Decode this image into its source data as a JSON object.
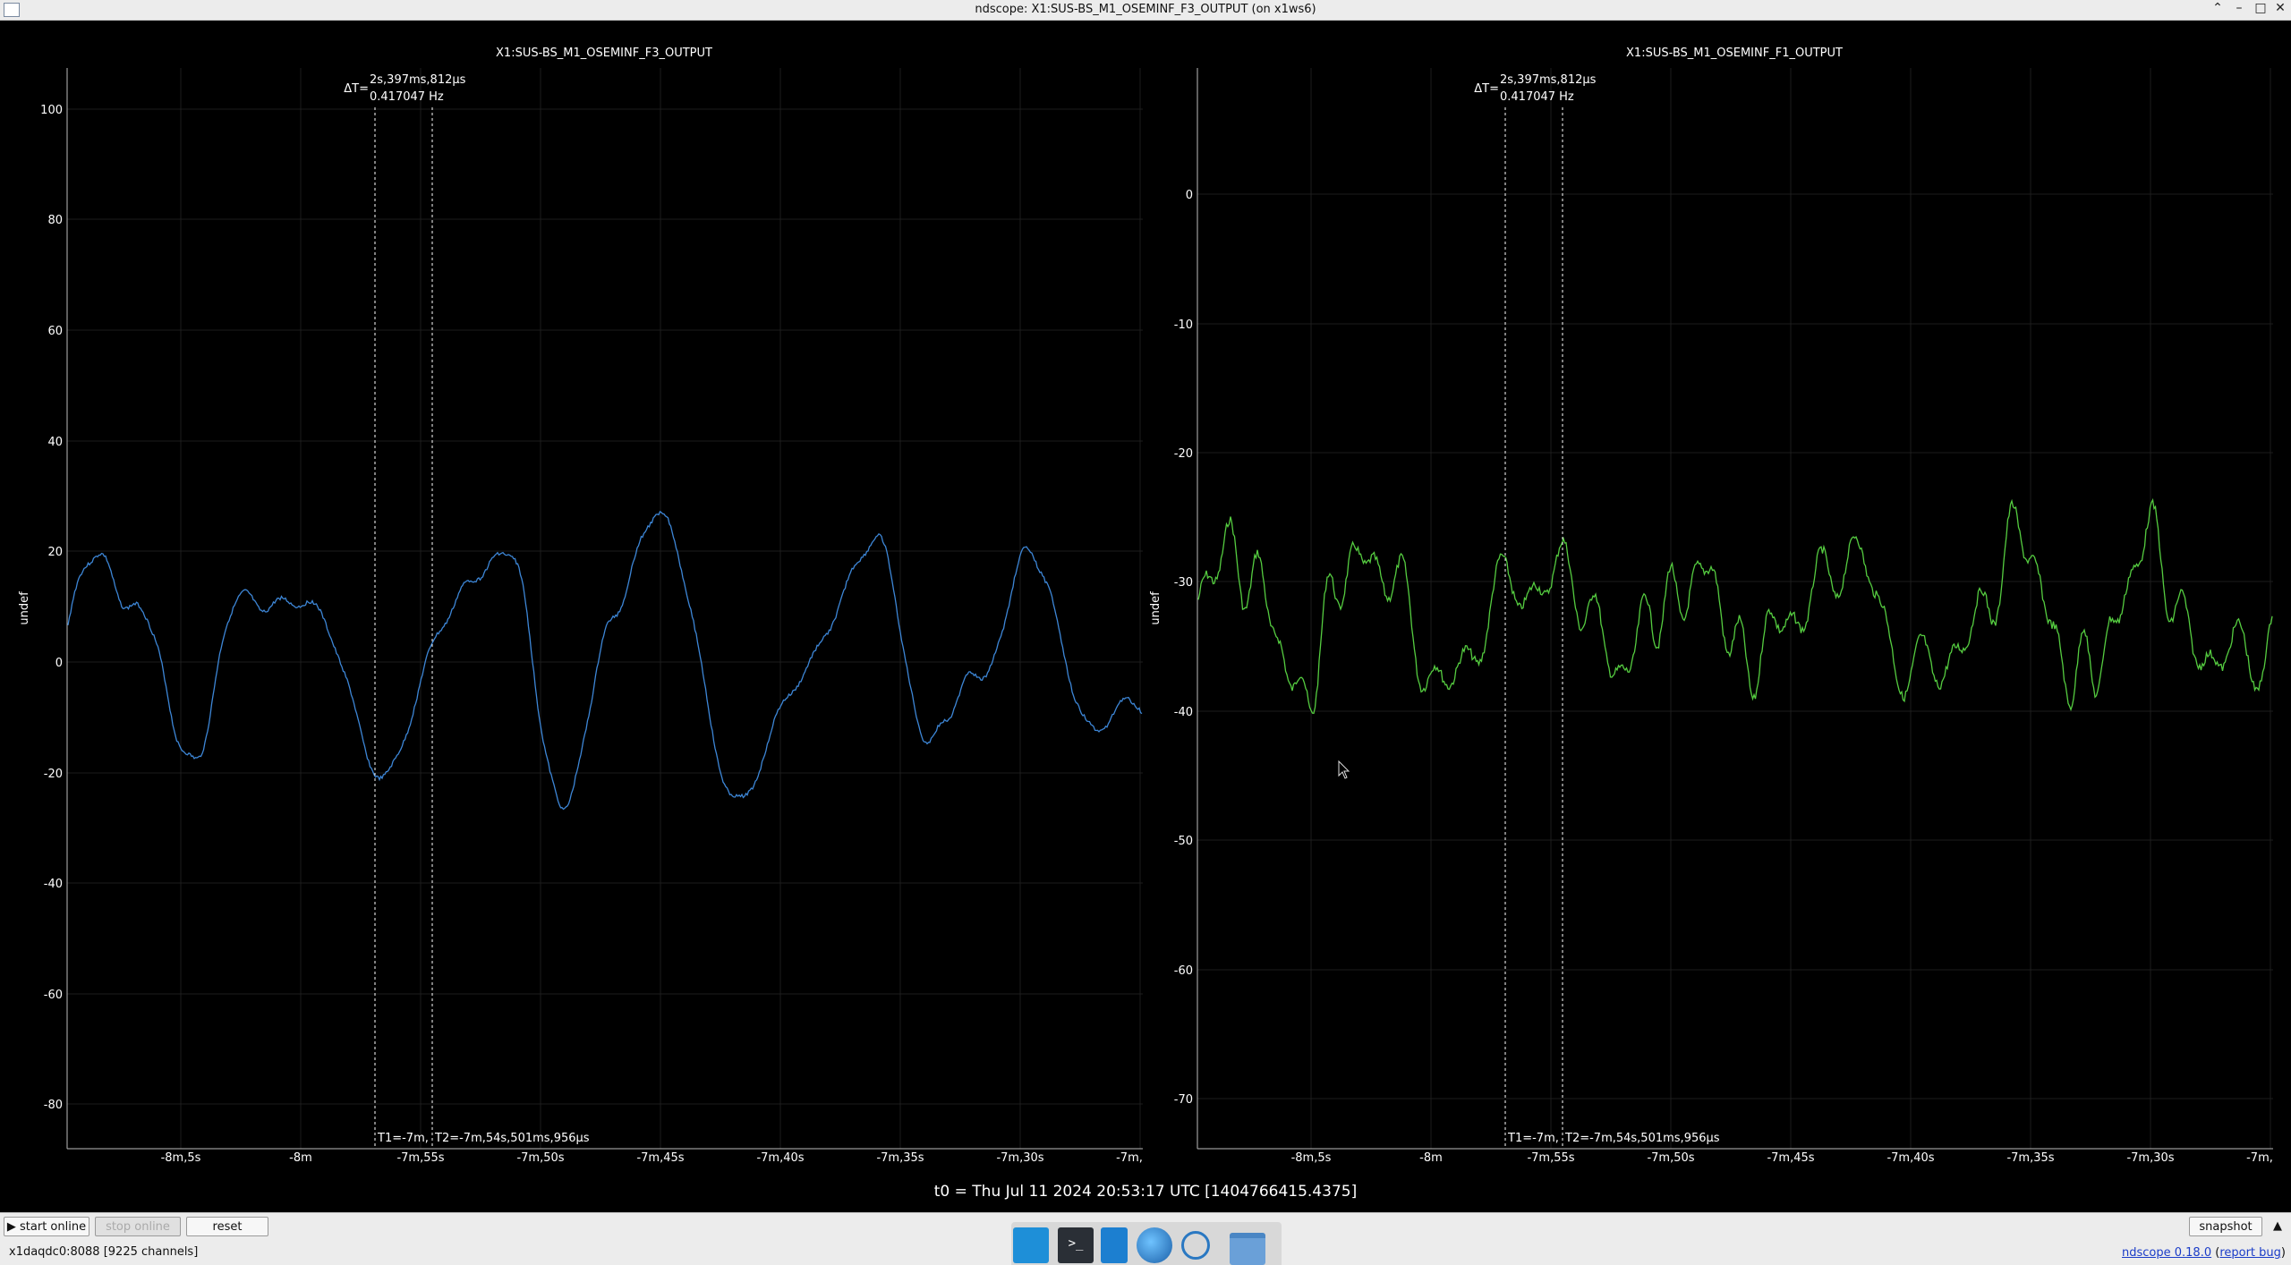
{
  "window": {
    "title": "ndscope: X1:SUS-BS_M1_OSEMINF_F3_OUTPUT (on x1ws6)",
    "controls": [
      "⌃",
      "–",
      "□",
      "✕"
    ]
  },
  "plots": [
    {
      "title": "X1:SUS-BS_M1_OSEMINF_F3_OUTPUT",
      "ylabel": "undef",
      "color": "#3d86d6",
      "yticks": [
        "100",
        "80",
        "60",
        "40",
        "20",
        "0",
        "-20",
        "-40",
        "-60",
        "-80"
      ],
      "xticks": [
        "-8m,5s",
        "-8m",
        "-7m,55s",
        "-7m,50s",
        "-7m,45s",
        "-7m,40s",
        "-7m,35s",
        "-7m,30s",
        "-7m,"
      ],
      "cursor_delta": {
        "label": "ΔT=",
        "time": "2s,397ms,812µs",
        "freq": "0.417047 Hz"
      },
      "cursor_t1": "T1=-7m,",
      "cursor_t2": "T2=-7m,54s,501ms,956µs"
    },
    {
      "title": "X1:SUS-BS_M1_OSEMINF_F1_OUTPUT",
      "ylabel": "undef",
      "color": "#55cc40",
      "yticks": [
        "0",
        "-10",
        "-20",
        "-30",
        "-40",
        "-50",
        "-60",
        "-70"
      ],
      "xticks": [
        "-8m,5s",
        "-8m",
        "-7m,55s",
        "-7m,50s",
        "-7m,45s",
        "-7m,40s",
        "-7m,35s",
        "-7m,30s",
        "-7m,"
      ],
      "cursor_delta": {
        "label": "ΔT=",
        "time": "2s,397ms,812µs",
        "freq": "0.417047 Hz"
      },
      "cursor_t1": "T1=-7m,",
      "cursor_t2": "T2=-7m,54s,501ms,956µs"
    }
  ],
  "t0_label": "t0 = Thu Jul 11 2024 20:53:17 UTC [1404766415.4375]",
  "buttons": {
    "start_online": "▶ start online",
    "stop_online": "stop online",
    "reset": "reset",
    "snapshot": "snapshot",
    "expand": "▲"
  },
  "status": "x1daqdc0:8088  [9225 channels]",
  "version": {
    "name": "ndscope 0.18.0",
    "open": " (",
    "report": "report bug",
    "close": ")"
  },
  "taskbar_icons": [
    "desktop-icon",
    "terminal-icon",
    "editor-icon",
    "browser-icon",
    "search-icon",
    "folder-icon"
  ]
}
